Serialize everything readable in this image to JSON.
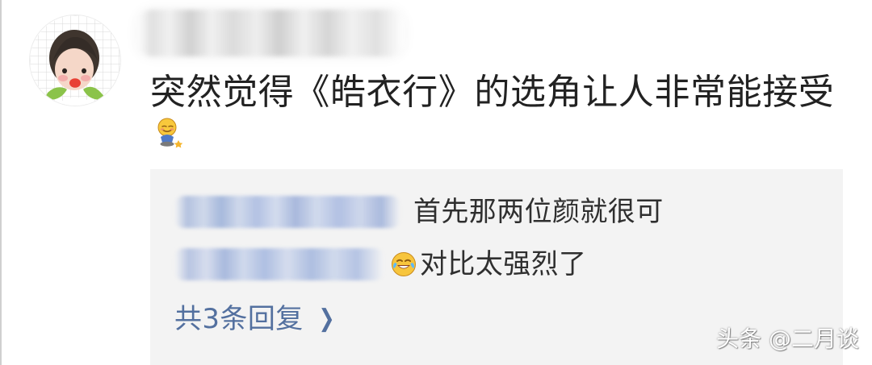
{
  "post": {
    "comment_text": "突然觉得《皓衣行》的选角让人非常能接受",
    "sticker_icon": "blush-sit-emoji",
    "avatar_icon": "child-avatar"
  },
  "replies": {
    "items": [
      {
        "text": "首先那两位颜就很可"
      },
      {
        "emoji_icon": "laugh-cry-emoji",
        "text": "对比太强烈了"
      }
    ],
    "view_more_label": "共3条回复",
    "view_more_icon": "chevron-right-icon"
  },
  "watermark": {
    "text": "头条 @二月谈"
  },
  "colors": {
    "background": "#ffffff",
    "reply_background": "#f3f3f3",
    "text": "#222222",
    "link": "#53709f",
    "watermark_text": "#ffffff"
  }
}
